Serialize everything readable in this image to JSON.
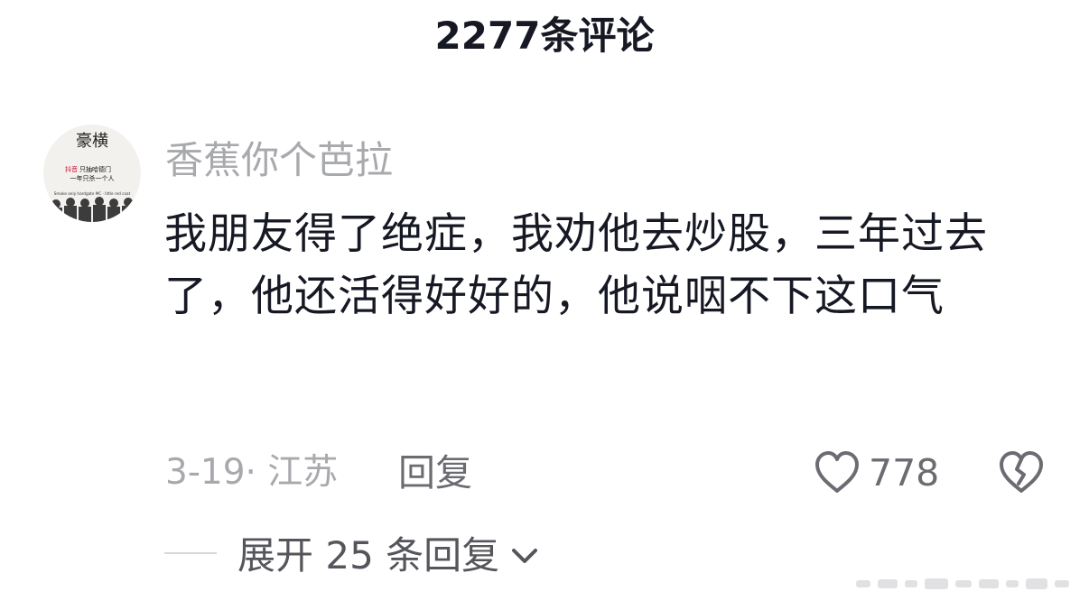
{
  "header": {
    "title": "2277条评论"
  },
  "comment": {
    "username": "香蕉你个芭拉",
    "text": "我朋友得了绝症，我劝他去炒股，三年过去了，他还活得好好的，他说咽不下这口气",
    "date_location": "3-19· 江苏",
    "reply_label": "回复",
    "like_count": "778"
  },
  "avatar": {
    "title_text": "豪横",
    "red_text": "抖音",
    "line1": "只抽哈德门",
    "line2": "一年只杀一个人",
    "line3": "Smoke only hardgate MC · little red coat"
  },
  "replies": {
    "expand_label": "展开 25 条回复"
  },
  "colors": {
    "primary_text": "#161823",
    "secondary_text": "#a8a9ad",
    "reply_text": "#55565c",
    "accent_red": "#c8102e"
  },
  "icons": {
    "like": "heart-outline-icon",
    "dislike": "broken-heart-icon",
    "expand": "chevron-down-icon"
  }
}
